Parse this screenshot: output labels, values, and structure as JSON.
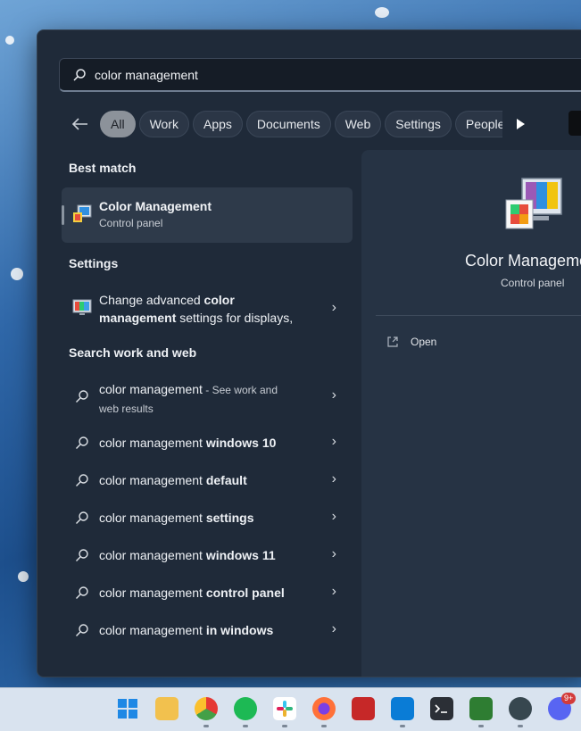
{
  "search": {
    "value": "color management",
    "placeholder": ""
  },
  "filters": [
    {
      "label": "All",
      "active": true
    },
    {
      "label": "Work",
      "active": false
    },
    {
      "label": "Apps",
      "active": false
    },
    {
      "label": "Documents",
      "active": false
    },
    {
      "label": "Web",
      "active": false
    },
    {
      "label": "Settings",
      "active": false
    },
    {
      "label": "People",
      "active": false
    }
  ],
  "sections": {
    "best_match": "Best match",
    "settings": "Settings",
    "search_web": "Search work and web"
  },
  "best_match": {
    "title": "Color Management",
    "subtitle": "Control panel",
    "icon": "color-management-icon"
  },
  "settings_item": {
    "pre": "Change advanced ",
    "bold1": "color",
    "bold2": "management",
    "post": " settings for displays,",
    "icon": "monitor-icon"
  },
  "web_results": [
    {
      "prefix": "color management",
      "bold": "",
      "note": " - See work and",
      "note2": "web results"
    },
    {
      "prefix": "color management ",
      "bold": "windows 10"
    },
    {
      "prefix": "color management ",
      "bold": "default"
    },
    {
      "prefix": "color management ",
      "bold": "settings"
    },
    {
      "prefix": "color management ",
      "bold": "windows 11"
    },
    {
      "prefix": "color management ",
      "bold": "control panel"
    },
    {
      "prefix": "color management ",
      "bold": "in windows"
    }
  ],
  "preview": {
    "title": "Color Management",
    "subtitle": "Control panel",
    "open_label": "Open"
  },
  "taskbar": {
    "apps": [
      "start",
      "file-explorer",
      "chrome",
      "spotify",
      "slack",
      "firefox",
      "app-red",
      "vscode",
      "terminal",
      "monitor-app",
      "audio-app",
      "discord"
    ],
    "discord_badge": "9+"
  },
  "colors": {
    "panel": "#1f2a39",
    "accent_chip": "#8c929a",
    "taskbar": "#d9e3ef"
  }
}
